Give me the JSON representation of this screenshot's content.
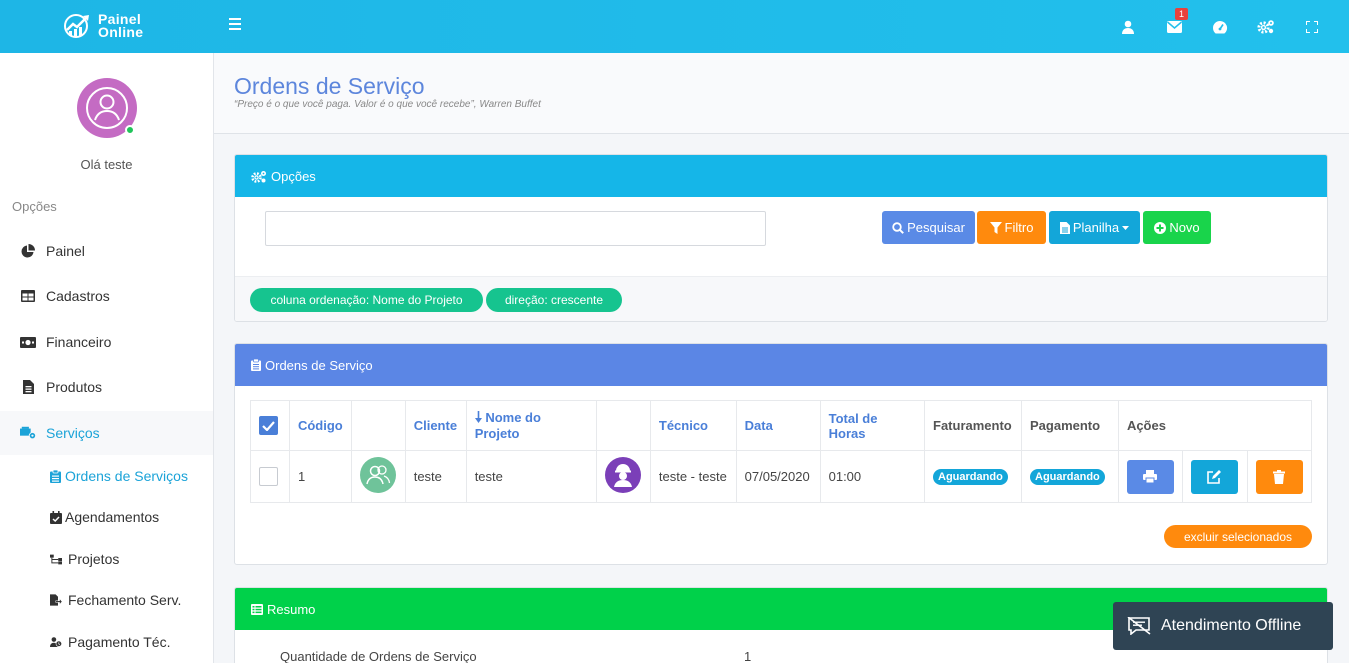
{
  "brand": {
    "line1": "Painel",
    "line2": "Online"
  },
  "topbar": {
    "mail_badge": "1"
  },
  "sidebar": {
    "greeting": "Olá teste",
    "heading": "Opções",
    "items": [
      {
        "label": "Painel"
      },
      {
        "label": "Cadastros"
      },
      {
        "label": "Financeiro"
      },
      {
        "label": "Produtos"
      },
      {
        "label": "Serviços"
      }
    ],
    "subitems": [
      {
        "label": "Ordens de Serviços"
      },
      {
        "label": "Agendamentos"
      },
      {
        "label": "Projetos"
      },
      {
        "label": "Fechamento Serv."
      },
      {
        "label": "Pagamento Téc."
      }
    ]
  },
  "header": {
    "title": "Ordens de Serviço",
    "quote": "“Preço é o que você paga. Valor é o que você recebe”, Warren Buffet"
  },
  "options": {
    "title": "Opções",
    "search_placeholder": "",
    "buttons": {
      "search": "Pesquisar",
      "filter": "Filtro",
      "sheet": "Planilha",
      "new": "Novo"
    },
    "pills": {
      "order_column": "coluna ordenação: Nome do Projeto",
      "direction": "direção: crescente"
    }
  },
  "orders": {
    "title": "Ordens de Serviço",
    "columns": [
      "Código",
      "Cliente",
      "Nome do Projeto",
      "Técnico",
      "Data",
      "Total de Horas",
      "Faturamento",
      "Pagamento",
      "Ações"
    ],
    "rows": [
      {
        "code": "1",
        "client": "teste",
        "project": "teste",
        "technician": "teste - teste",
        "date": "07/05/2020",
        "hours": "01:00",
        "billing": "Aguardando",
        "payment": "Aguardando"
      }
    ],
    "delete_selected": "excluir selecionados"
  },
  "summary": {
    "title": "Resumo",
    "rows": [
      {
        "label": "Quantidade de Ordens de Serviço",
        "value": "1"
      }
    ]
  },
  "chat": {
    "label": "Atendimento Offline"
  },
  "colors": {
    "topbar": "#22c0ec",
    "options_header": "#15b6e8",
    "orders_header": "#5b86e5",
    "summary_header": "#00d14a",
    "accent_blue": "#4a7fd8",
    "orange": "#ff8a0d",
    "green_button": "#19d44b",
    "status_badge": "#13a6d9"
  },
  "icons": [
    "user-icon",
    "mail-icon",
    "gauge-icon",
    "cogs-icon",
    "fullscreen-icon",
    "pie-chart-icon",
    "table-icon",
    "money-icon",
    "file-icon",
    "cart-gear-icon",
    "clipboard-icon",
    "calendar-check-icon",
    "sitemap-icon",
    "file-export-icon",
    "user-clock-icon",
    "search-icon",
    "filter-icon",
    "file-sheet-icon",
    "plus-circle-icon",
    "list-icon",
    "print-icon",
    "edit-icon",
    "trash-icon",
    "offline-chat-icon"
  ]
}
